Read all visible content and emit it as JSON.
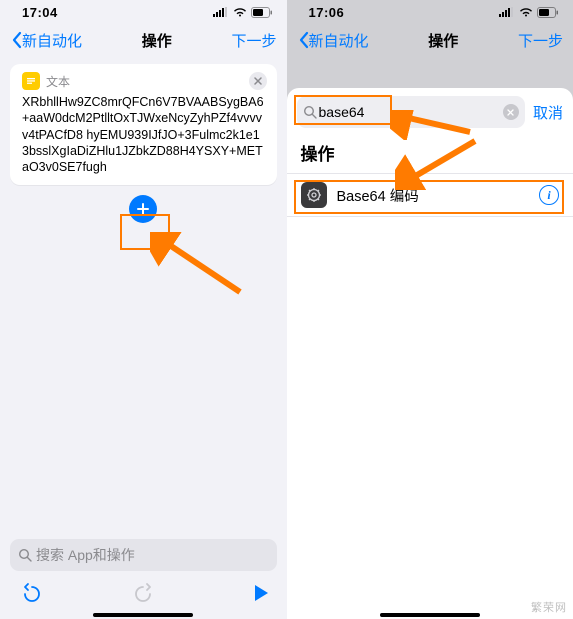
{
  "left": {
    "status": {
      "time": "17:04"
    },
    "nav": {
      "back": "新自动化",
      "title": "操作",
      "next": "下一步"
    },
    "card": {
      "icon_label": "文本",
      "body": "XRbhllHw9ZC8mrQFCn6V7BVAABSygBA6+aaW0dcM2PtlltOxTJWxeNcyZyhPZf4vvvvv4tPACfD8\nhyEMU939IJfJO+3Fulmc2k1e13bsslXgIaDiZHlu1JZbkZD88H4YSXY+METaO3v0SE7fugh"
    },
    "search": {
      "placeholder": "搜索 App和操作"
    }
  },
  "right": {
    "status": {
      "time": "17:06"
    },
    "nav": {
      "back": "新自动化",
      "title": "操作",
      "next": "下一步"
    },
    "sheet": {
      "search_value": "base64",
      "cancel": "取消",
      "title": "操作",
      "results": [
        {
          "label": "Base64 编码"
        }
      ]
    }
  },
  "watermark": "繁荣网"
}
